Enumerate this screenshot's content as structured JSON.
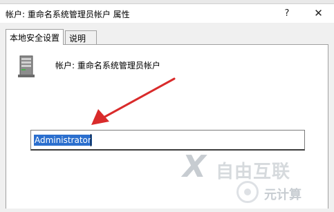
{
  "dialog": {
    "title": "帐户: 重命名系统管理员帐户 属性",
    "help_glyph": "?",
    "close_glyph": "✕"
  },
  "tabs": [
    {
      "label": "本地安全设置",
      "active": true
    },
    {
      "label": "说明",
      "active": false
    }
  ],
  "setting": {
    "label": "帐户: 重命名系统管理员帐户",
    "icon": "user-account-icon"
  },
  "name_field": {
    "value": "Administrator",
    "selected": true
  },
  "watermark": {
    "brand": "自由互联",
    "sub": "元计算"
  },
  "colors": {
    "selection": "#2b6fce",
    "arrow": "#d92b2b"
  }
}
